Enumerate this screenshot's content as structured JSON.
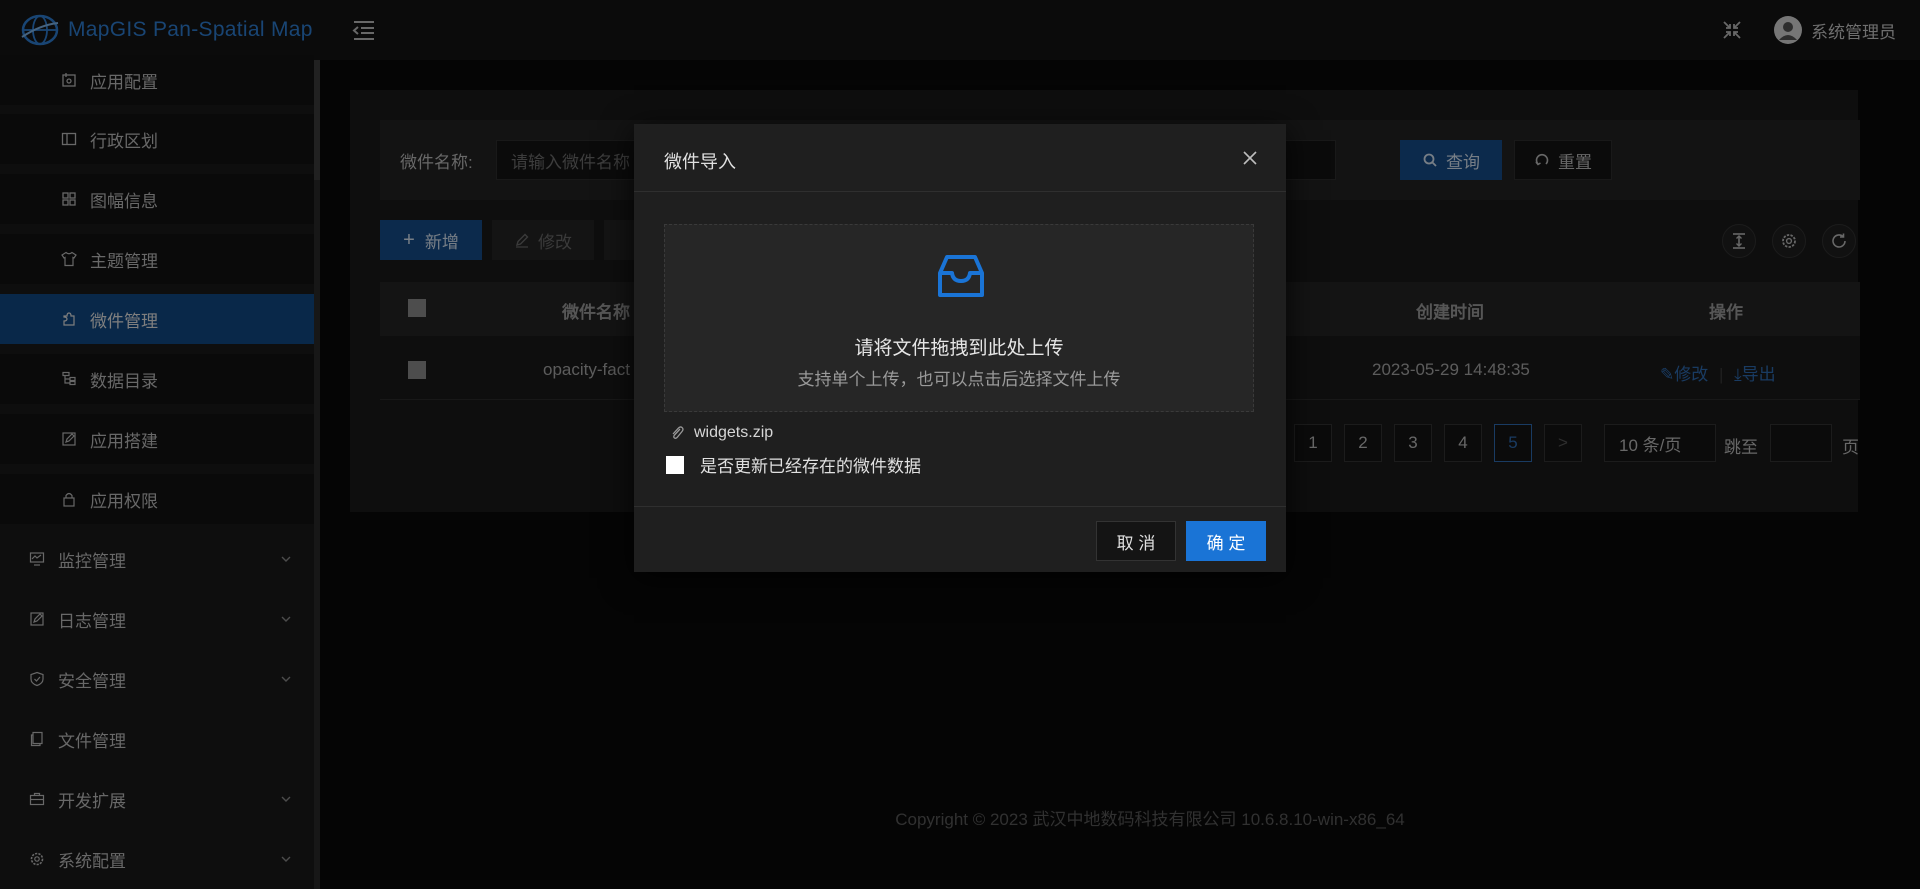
{
  "header": {
    "app_title": "MapGIS Pan-Spatial Map",
    "user_name": "系统管理员"
  },
  "sidebar": {
    "sub_items": [
      {
        "label": "应用配置",
        "icon": "settings-doc-icon"
      },
      {
        "label": "行政区划",
        "icon": "map-columns-icon"
      },
      {
        "label": "图幅信息",
        "icon": "grid-icon"
      },
      {
        "label": "主题管理",
        "icon": "shirt-icon"
      },
      {
        "label": "微件管理",
        "icon": "puzzle-icon",
        "active": true
      },
      {
        "label": "数据目录",
        "icon": "tree-icon"
      },
      {
        "label": "应用搭建",
        "icon": "edit-doc-icon"
      },
      {
        "label": "应用权限",
        "icon": "lock-icon"
      }
    ],
    "top_items": [
      {
        "label": "监控管理",
        "icon": "monitor-icon"
      },
      {
        "label": "日志管理",
        "icon": "log-icon"
      },
      {
        "label": "安全管理",
        "icon": "shield-icon"
      },
      {
        "label": "文件管理",
        "icon": "file-icon"
      },
      {
        "label": "开发扩展",
        "icon": "briefcase-icon"
      },
      {
        "label": "系统配置",
        "icon": "gear-icon"
      }
    ]
  },
  "search": {
    "label": "微件名称:",
    "placeholder": "请输入微件名称",
    "query_label": "查询",
    "reset_label": "重置"
  },
  "toolbar": {
    "add_label": "新增",
    "edit_label": "修改"
  },
  "table": {
    "columns": {
      "name": "微件名称",
      "created": "创建时间",
      "actions": "操作"
    },
    "rows": [
      {
        "name": "opacity-fact",
        "created": "2023-05-29 14:48:35",
        "edit": "修改",
        "export": "导出"
      }
    ]
  },
  "pagination": {
    "pages": [
      "1",
      "2",
      "3",
      "4",
      "5"
    ],
    "current": "5",
    "next": ">",
    "page_size": "10 条/页",
    "jump_label": "跳至",
    "page_suffix": "页"
  },
  "footer": {
    "copyright": "Copyright © 2023 武汉中地数码科技有限公司 10.6.8.10-win-x86_64"
  },
  "modal": {
    "title": "微件导入",
    "dropzone_title": "请将文件拖拽到此处上传",
    "dropzone_hint": "支持单个上传，也可以点击后选择文件上传",
    "file_name": "widgets.zip",
    "update_option_label": "是否更新已经存在的微件数据",
    "cancel_label": "取 消",
    "ok_label": "确 定"
  },
  "colors": {
    "accent": "#1a74d6",
    "active_menu": "#124a85",
    "link": "#2f6cb3"
  }
}
